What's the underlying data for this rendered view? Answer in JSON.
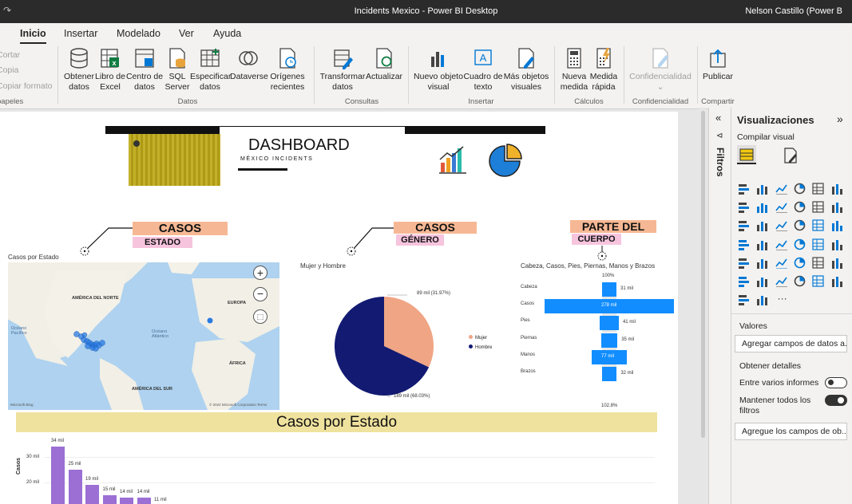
{
  "window": {
    "title": "Incidents Mexico - Power BI Desktop",
    "user": "Nelson Castillo (Power B"
  },
  "tabs": [
    "Inicio",
    "Insertar",
    "Modelado",
    "Ver",
    "Ayuda"
  ],
  "clipboard": {
    "cut": "Cortar",
    "copy": "Copia",
    "format": "Copiar formato",
    "group": "papeles"
  },
  "ribbon": {
    "obtener": "Obtener\ndatos",
    "excel": "Libro de\nExcel",
    "centro": "Centro de\ndatos",
    "sql": "SQL\nServer",
    "especificar": "Especificar\ndatos",
    "dataverse": "Dataverse",
    "origenes": "Orígenes\nrecientes",
    "transformar": "Transformar\ndatos",
    "actualizar": "Actualizar",
    "nuevo_visual": "Nuevo objeto\nvisual",
    "cuadro": "Cuadro de\ntexto",
    "mas_visuales": "Más objetos\nvisuales",
    "nueva_medida": "Nueva\nmedida",
    "medida_rapida": "Medida\nrápida",
    "confidencialidad": "Confidencialidad",
    "publicar": "Publicar",
    "groups": {
      "datos": "Datos",
      "consultas": "Consultas",
      "insertar": "Insertar",
      "calculos": "Cálculos",
      "confidencialidad": "Confidencialidad",
      "compartir": "Compartir"
    }
  },
  "dashboard": {
    "title": "DASHBOARD",
    "subtitle": "MÉXICO INCIDENTS",
    "section1": {
      "main": "CASOS",
      "sub": "ESTADO"
    },
    "section2": {
      "main": "CASOS",
      "sub": "GÉNERO"
    },
    "section3": {
      "main": "PARTE DEL",
      "sub": "CUERPO"
    }
  },
  "map": {
    "title": "Casos por Estado",
    "labels": {
      "na": "AMÉRICA DEL NORTE",
      "europe": "EUROPA",
      "pacific": "Océano\nPacífico",
      "atlantic": "Océano\nAtlántico",
      "africa": "ÁFRICA",
      "sa": "AMÉRICA DEL SUR"
    },
    "credit": "© 2022 Microsoft Corporation  Terms",
    "bing": "Microsoft Bing"
  },
  "pie": {
    "title": "Mujer y Hombre",
    "label_top": "89 mil (31.97%)",
    "label_bottom": "189 mil (68.03%)",
    "legend": [
      {
        "name": "Mujer",
        "color": "#f0a585"
      },
      {
        "name": "Hombre",
        "color": "#121a72"
      }
    ],
    "chart_data": {
      "type": "pie",
      "slices": [
        {
          "name": "Mujer",
          "value": 89,
          "pct": 31.97
        },
        {
          "name": "Hombre",
          "value": 189,
          "pct": 68.03
        }
      ]
    }
  },
  "funnel": {
    "title": "Cabeza, Casos, Pies, Piernas, Manos y Brazos",
    "top": "100%",
    "bottom": "102.8%",
    "chart_data": {
      "type": "bar",
      "categories": [
        "Cabeza",
        "Casos",
        "Pies",
        "Piernas",
        "Manos",
        "Brazos"
      ],
      "values": [
        31,
        278,
        41,
        35,
        77,
        32
      ],
      "labels": [
        "31 mil",
        "278 mil",
        "41 mil",
        "35 mil",
        "77 mil",
        "32 mil"
      ]
    }
  },
  "estado": {
    "title": "Casos por Estado",
    "ylabel": "Casos",
    "yticks": [
      "30 mil",
      "20 mil"
    ],
    "chart_data": {
      "type": "bar",
      "values": [
        34,
        25,
        19,
        15,
        14,
        14,
        11
      ],
      "labels": [
        "34 mil",
        "25 mil",
        "19 mil",
        "15 mil",
        "14 mil",
        "14 mil",
        "11 mil"
      ]
    }
  },
  "viz": {
    "title": "Visualizaciones",
    "build": "Compilar visual",
    "values": "Valores",
    "values_box": "Agregar campos de datos a...",
    "details": "Obtener detalles",
    "cross": "Entre varios informes",
    "keep": "Mantener todos los filtros",
    "drill_box": "Agregue los campos de ob...",
    "more": "···",
    "filters": "Filtros"
  }
}
